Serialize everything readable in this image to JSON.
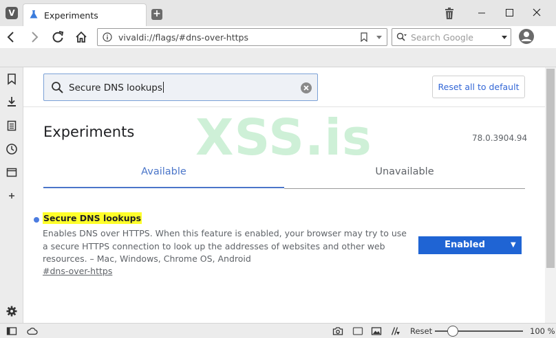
{
  "window": {
    "tab_title": "Experiments"
  },
  "navbar": {
    "url": "vivaldi://flags/#dns-over-https",
    "search_placeholder": "Search Google"
  },
  "page": {
    "search_value": "Secure DNS lookups",
    "reset_all_label": "Reset all to default",
    "title": "Experiments",
    "version": "78.0.3904.94",
    "tabs": [
      {
        "label": "Available",
        "active": true
      },
      {
        "label": "Unavailable",
        "active": false
      }
    ],
    "watermark": "XSS.is"
  },
  "flag": {
    "name": "Secure DNS lookups",
    "description": "Enables DNS over HTTPS. When this feature is enabled, your browser may try to use a secure HTTPS connection to look up the addresses of websites and other web resources. – Mac, Windows, Chrome OS, Android",
    "link": "#dns-over-https",
    "selected_option": "Enabled"
  },
  "statusbar": {
    "reset_label": "Reset",
    "zoom_label": "100 %",
    "zoom_percent": 100
  },
  "colors": {
    "accent": "#4a75c9",
    "select_bg": "#1f64d4",
    "highlight": "#ffff2a"
  }
}
